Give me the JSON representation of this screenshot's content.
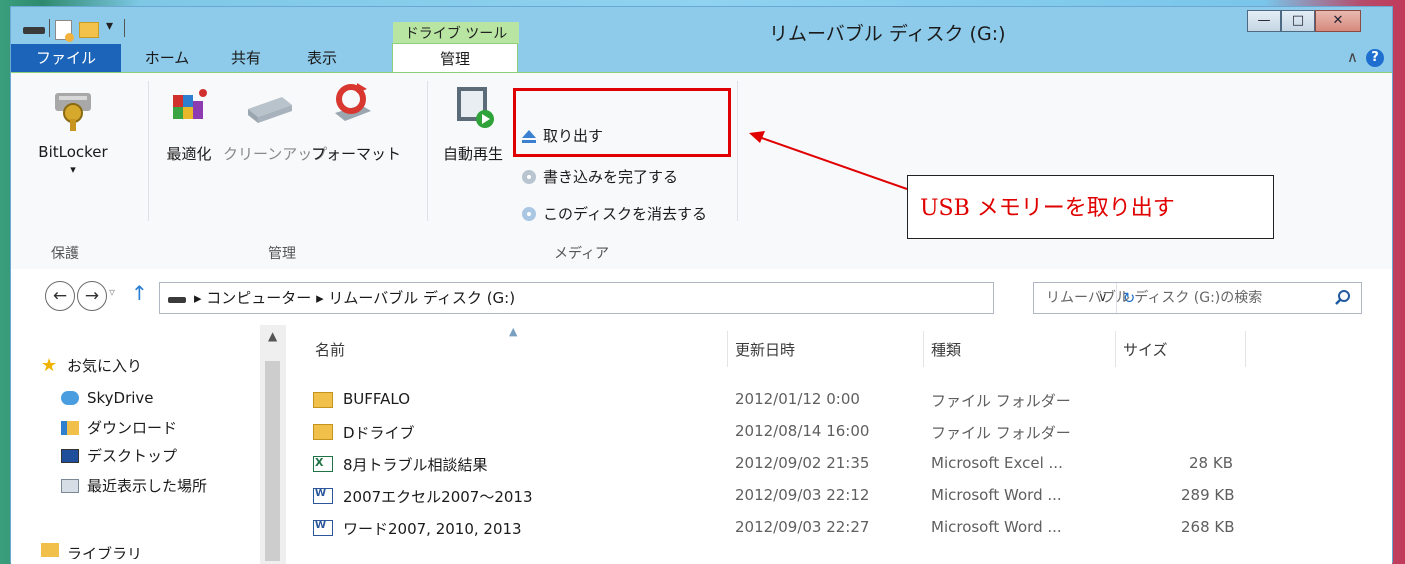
{
  "window": {
    "title": "リムーバブル ディスク (G:)",
    "context_tab": "ドライブ ツール",
    "quick_access_arrow": "▾",
    "controls": {
      "minimize": "—",
      "maximize": "□",
      "close": "✕"
    }
  },
  "tabs": {
    "file": "ファイル",
    "home": "ホーム",
    "share": "共有",
    "view": "表示",
    "manage": "管理",
    "collapse_glyph": "∧",
    "help_glyph": "?"
  },
  "ribbon": {
    "groups": [
      {
        "label": "保護"
      },
      {
        "label": "管理"
      },
      {
        "label": "メディア"
      }
    ],
    "buttons": {
      "bitlocker": "BitLocker",
      "bitlocker_arrow": "▾",
      "optimize": "最適化",
      "cleanup": "クリーンアップ",
      "format": "フォーマット",
      "autoplay": "自動再生",
      "eject": "取り出す",
      "finish_burning": "書き込みを完了する",
      "erase_disc": "このディスクを消去する"
    },
    "callout_text": "USB メモリーを取り出す"
  },
  "address": {
    "back": "←",
    "forward": "→",
    "dropdown": "▿",
    "up": "↑",
    "crumbs": "▸ コンピューター ▸ リムーバブル ディスク (G:)",
    "addr_dropdown": "∨",
    "refresh": "↻",
    "search_placeholder": "リムーバブル ディスク (G:)の検索"
  },
  "nav_pane": {
    "items": [
      {
        "label": "お気に入り"
      },
      {
        "label": "SkyDrive"
      },
      {
        "label": "ダウンロード"
      },
      {
        "label": "デスクトップ"
      },
      {
        "label": "最近表示した場所"
      },
      {
        "label": "ライブラリ"
      }
    ]
  },
  "files": {
    "columns": {
      "name": "名前",
      "modified": "更新日時",
      "type": "種類",
      "size": "サイズ"
    },
    "rows": [
      {
        "name": "BUFFALO",
        "modified": "2012/01/12 0:00",
        "type": "ファイル フォルダー",
        "size": "",
        "icon": "folder-icon"
      },
      {
        "name": "Dドライブ",
        "modified": "2012/08/14 16:00",
        "type": "ファイル フォルダー",
        "size": "",
        "icon": "folder-icon"
      },
      {
        "name": "8月トラブル相談結果",
        "modified": "2012/09/02 21:35",
        "type": "Microsoft Excel ...",
        "size": "28 KB",
        "icon": "excel-file-icon"
      },
      {
        "name": "2007エクセル2007～2013",
        "modified": "2012/09/03 22:12",
        "type": "Microsoft Word ...",
        "size": "289 KB",
        "icon": "word-file-icon"
      },
      {
        "name": "ワード2007, 2010, 2013",
        "modified": "2012/09/03 22:27",
        "type": "Microsoft Word ...",
        "size": "268 KB",
        "icon": "word-file-icon"
      }
    ]
  },
  "colors": {
    "file_tab": "#1c64b9",
    "title_bg": "#8ecbea",
    "context_tab": "#b8e6a2",
    "highlight_red": "#e00000"
  }
}
